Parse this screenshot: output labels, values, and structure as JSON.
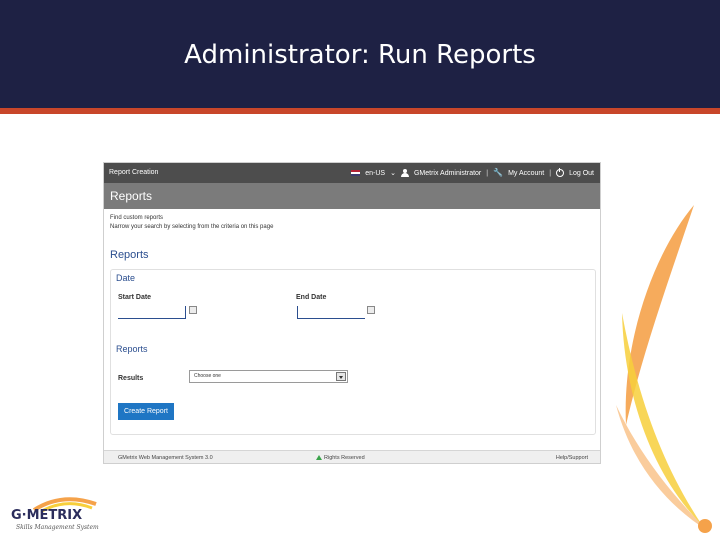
{
  "slide": {
    "title": "Administrator: Run Reports"
  },
  "app": {
    "topbar": {
      "title": "Report Creation",
      "language": "en-US",
      "user": "GMetrix Administrator",
      "account": "My Account",
      "logout": "Log Out"
    },
    "subbar_title": "Reports",
    "intro_line1": "Find custom reports",
    "intro_line2": "Narrow your search by selecting from the criteria on this page",
    "reports_heading": "Reports",
    "date_heading": "Date",
    "start_date_label": "Start Date",
    "end_date_label": "End Date",
    "reports_sub_heading": "Reports",
    "results_label": "Results",
    "results_selected": "Choose one",
    "create_button": "Create Report",
    "footer": {
      "left": "GMetrix Web Management System 3.0",
      "mid": "Rights Reserved",
      "right": "Help/Support"
    }
  },
  "logo": {
    "text": "G·METRIX",
    "sub": "Skills Management System"
  },
  "colors": {
    "header_bg": "#1e2144",
    "header_rule": "#c8462a",
    "accent_blue": "#2b4e8f",
    "button_blue": "#1f76c4",
    "swoosh_orange": "#f5a24a",
    "swoosh_yellow": "#f7cf3b"
  }
}
